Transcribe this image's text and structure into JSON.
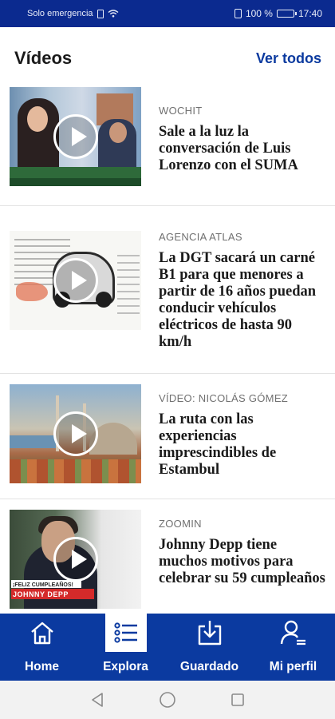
{
  "status_bar": {
    "carrier": "Solo emergencia",
    "battery": "100 %",
    "time": "17:40",
    "icons": [
      "sim-icon",
      "wifi-icon",
      "vibrate-icon",
      "battery-icon"
    ]
  },
  "header": {
    "title": "Vídeos",
    "see_all": "Ver todos"
  },
  "videos": [
    {
      "source": "WOCHIT",
      "headline": "Sale a la luz la conversación de Luis Lorenzo con el SUMA"
    },
    {
      "source": "AGENCIA ATLAS",
      "headline": "La DGT sacará un carné B1 para que menores a partir de 16 años puedan conducir vehículos eléctricos de hasta 90 km/h"
    },
    {
      "source": "VÍDEO: NICOLÁS GÓMEZ",
      "headline": "La ruta con las experiencias imprescindibles de Estambul"
    },
    {
      "source": "ZOOMIN",
      "headline": "Johnny Depp tiene muchos motivos para celebrar su 59 cumpleaños",
      "thumb_banner_top": "¡FELIZ CUMPLEAÑOS!",
      "thumb_banner": "JOHNNY DEPP"
    }
  ],
  "bottom_nav": {
    "items": [
      {
        "label": "Home",
        "icon": "home-icon",
        "active": false
      },
      {
        "label": "Explora",
        "icon": "list-icon",
        "active": true
      },
      {
        "label": "Guardado",
        "icon": "download-icon",
        "active": false
      },
      {
        "label": "Mi perfil",
        "icon": "profile-icon",
        "active": false
      }
    ]
  },
  "colors": {
    "brand_blue": "#0b3aa0",
    "status_bar": "#0b2a8f",
    "link": "#0b3a9f"
  }
}
